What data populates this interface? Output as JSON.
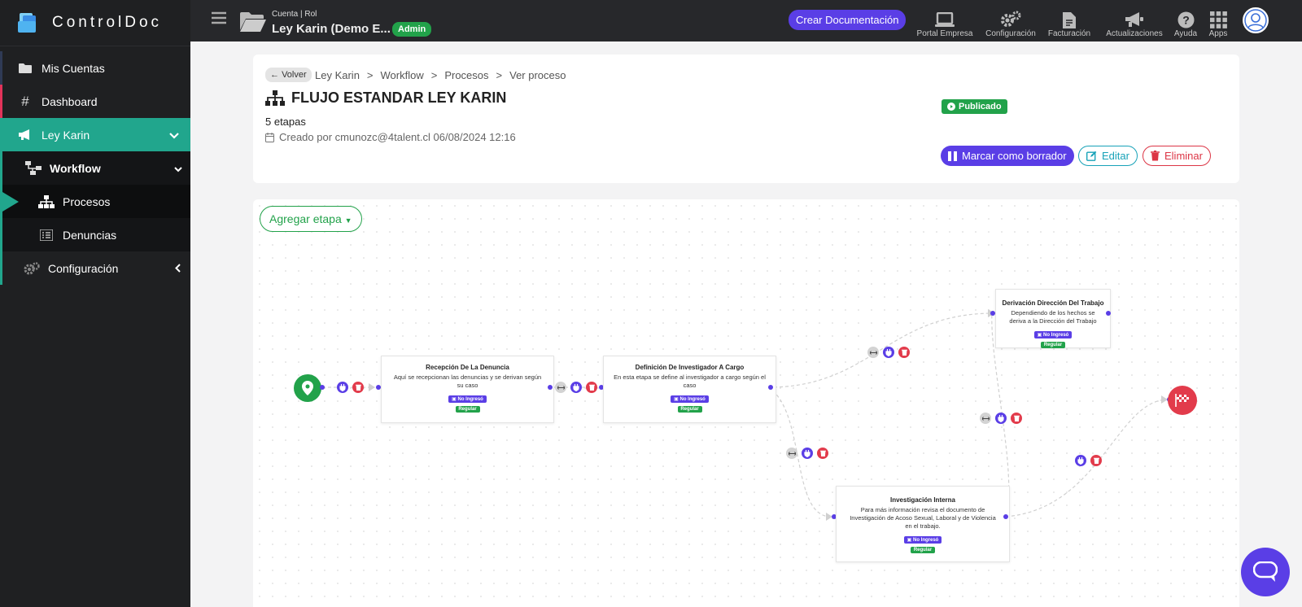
{
  "brand": {
    "name": "ControlDoc"
  },
  "sidebar": {
    "items": [
      {
        "label": "Mis Cuentas"
      },
      {
        "label": "Dashboard"
      },
      {
        "label": "Ley Karin"
      },
      {
        "label": "Workflow"
      },
      {
        "label": "Procesos"
      },
      {
        "label": "Denuncias"
      },
      {
        "label": "Configuración"
      }
    ]
  },
  "topbar": {
    "account_label": "Cuenta | Rol",
    "account_name": "Ley Karin (Demo E...",
    "role_badge": "Admin",
    "create_button": "Crear Documentación",
    "tools": [
      {
        "label": "Portal Empresa",
        "icon": "laptop-icon"
      },
      {
        "label": "Configuración",
        "icon": "gears-icon"
      },
      {
        "label": "Facturación",
        "icon": "invoice-icon"
      },
      {
        "label": "Actualizaciones",
        "icon": "megaphone-icon"
      },
      {
        "label": "Ayuda",
        "icon": "question-icon"
      },
      {
        "label": "Apps",
        "icon": "grid-icon"
      }
    ]
  },
  "header": {
    "back_label": "Volver",
    "breadcrumb": [
      "Ley Karin",
      ">",
      "Workflow",
      ">",
      "Procesos",
      ">",
      "Ver proceso"
    ],
    "title": "FLUJO ESTANDAR LEY KARIN",
    "stages": "5 etapas",
    "created": "Creado por cmunozc@4talent.cl 06/08/2024 12:16",
    "status": "Publicado",
    "btn_draft": "Marcar como borrador",
    "btn_edit": "Editar",
    "btn_delete": "Eliminar"
  },
  "canvas": {
    "add_stage": "Agregar etapa",
    "nodes": [
      {
        "title": "Recepción De La Denuncia",
        "desc": "Aquí se recepcionan las denuncias y se derivan según su caso",
        "badge": "No Ingresó",
        "tag": "Regular"
      },
      {
        "title": "Definición De Investigador A Cargo",
        "desc": "En esta etapa se define al investigador a cargo según el caso",
        "badge": "No Ingresó",
        "tag": "Regular"
      },
      {
        "title": "Derivación Dirección Del Trabajo",
        "desc": "Dependiendo de los hechos se deriva a la Dirección del Trabajo",
        "badge": "No Ingresó",
        "tag": "Regular"
      },
      {
        "title": "Investigación Interna",
        "desc": "Para más información revisa el documento de Investigación de Acoso Sexual, Laboral y de Violencia en el trabajo.",
        "badge": "No Ingresó",
        "tag": "Regular"
      }
    ]
  },
  "colors": {
    "accent": "#5a3ee6",
    "success": "#22a24a",
    "danger": "#e23b4b",
    "teal": "#21a68d"
  }
}
